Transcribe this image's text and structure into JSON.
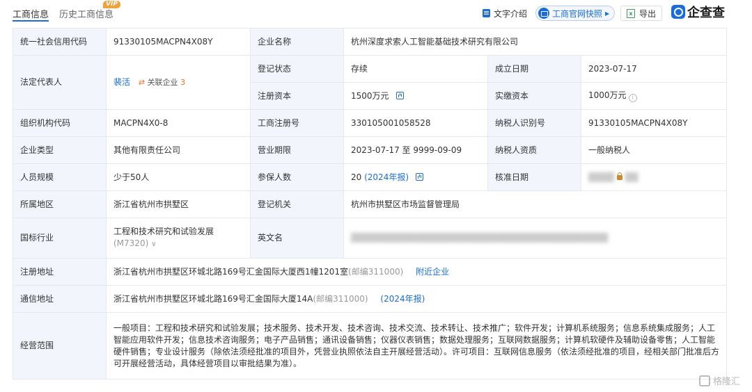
{
  "tabs": [
    {
      "label": "工商信息",
      "active": true
    },
    {
      "label": "历史工商信息",
      "badge": "VIP"
    }
  ],
  "toolbar": {
    "text_intro": "文字介绍",
    "snapshot": "工商官网快照",
    "export": "导出",
    "excel_glyph": "x",
    "brand": "企查查"
  },
  "rows": {
    "credit_code_label": "统一社会信用代码",
    "credit_code": "91330105MACPN4X08Y",
    "company_name_label": "企业名称",
    "company_name": "杭州深度求索人工智能基础技术研究有限公司",
    "legal_rep_label": "法定代表人",
    "legal_rep": "裴活",
    "related_label": "关联企业",
    "related_count": "3",
    "reg_status_label": "登记状态",
    "reg_status": "存续",
    "est_date_label": "成立日期",
    "est_date": "2023-07-17",
    "reg_capital_label": "注册资本",
    "reg_capital": "1500万元",
    "paid_capital_label": "实缴资本",
    "paid_capital": "1000万元",
    "org_code_label": "组织机构代码",
    "org_code": "MACPN4X0-8",
    "biz_reg_no_label": "工商注册号",
    "biz_reg_no": "330105001058528",
    "taxpayer_id_label": "纳税人识别号",
    "taxpayer_id": "91330105MACPN4X08Y",
    "company_type_label": "企业类型",
    "company_type": "其他有限责任公司",
    "biz_term_label": "营业期限",
    "biz_term": "2023-07-17 至 9999-09-09",
    "taxpayer_qual_label": "纳税人资质",
    "taxpayer_qual": "一般纳税人",
    "staff_size_label": "人员规模",
    "staff_size": "少于50人",
    "insured_label": "参保人数",
    "insured": "20",
    "insured_report": "(2024年报)",
    "approval_date_label": "核准日期",
    "region_label": "所属地区",
    "region": "浙江省杭州市拱墅区",
    "reg_authority_label": "登记机关",
    "reg_authority": "杭州市拱墅区市场监督管理局",
    "industry_label": "国标行业",
    "industry": "工程和技术研究和试验发展",
    "industry_code": "(M7320)",
    "english_name_label": "英文名",
    "reg_address_label": "注册地址",
    "reg_address": "浙江省杭州市拱墅区环城北路169号汇金国际大厦西1幢1201室",
    "reg_postcode": "(邮编311000)",
    "nearby_link": "附近企业",
    "mail_address_label": "通信地址",
    "mail_address": "浙江省杭州市拱墅区环城北路169号汇金国际大厦14A",
    "mail_postcode": "(邮编311000)",
    "mail_report": "(2024年报)",
    "scope_label": "经营范围",
    "scope": "一般项目：工程和技术研究和试验发展；技术服务、技术开发、技术咨询、技术交流、技术转让、技术推广；软件开发；计算机系统服务；信息系统集成服务；人工智能应用软件开发；信息技术咨询服务；电子产品销售；通讯设备销售；仪器仪表销售；数据处理服务；互联网数据服务；计算机软硬件及辅助设备零售；人工智能硬件销售；专业设计服务（除依法须经批准的项目外，凭营业执照依法自主开展经营活动）。许可项目：互联网信息服务（依法须经批准的项目，经相关部门批准后方可开展经营活动，具体经营项目以审批结果为准）。"
  },
  "watermark": "格隆汇",
  "colors": {
    "accent": "#1a6dd9",
    "label_bg": "#f2f6fc",
    "related_orange": "#f06a23",
    "vip": "#f0a23b"
  }
}
